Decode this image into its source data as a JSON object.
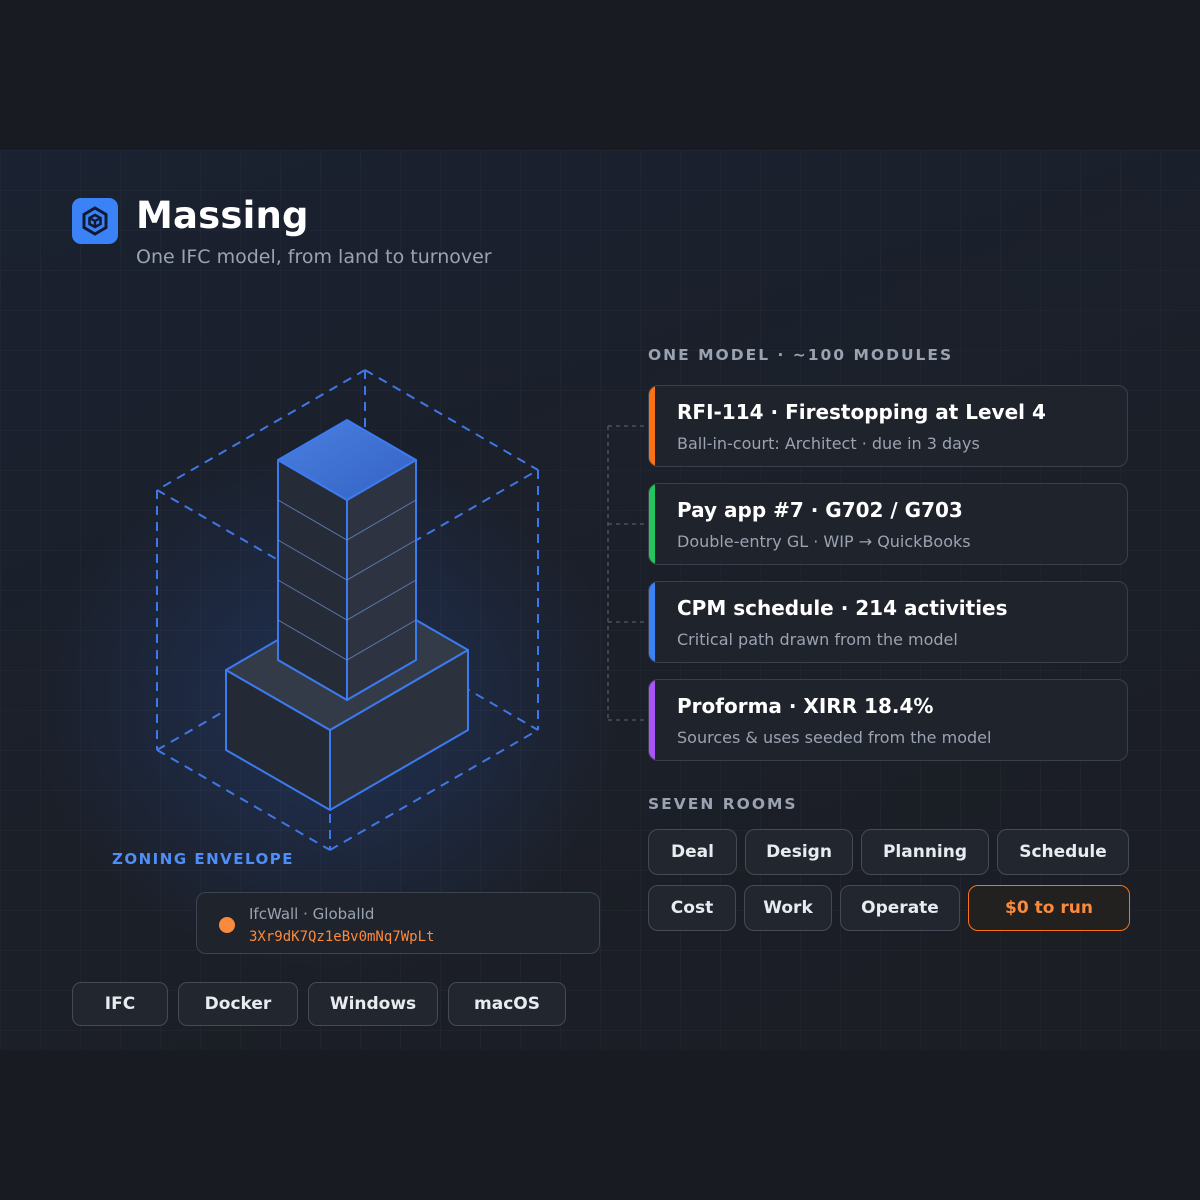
{
  "app": {
    "title": "Massing",
    "subtitle": "One IFC model, from land to turnover"
  },
  "visual": {
    "zoning_label": "ZONING ENVELOPE",
    "ifc_card": {
      "label": "IfcWall · GlobalId",
      "global_id": "3Xr9dK7Qz1eBv0mNq7WpLt"
    }
  },
  "platforms": [
    "IFC",
    "Docker",
    "Windows",
    "macOS"
  ],
  "modules": {
    "heading": "ONE MODEL · ~100 MODULES",
    "items": [
      {
        "title": "RFI-114 · Firestopping at Level 4",
        "subtitle": "Ball-in-court: Architect · due in 3 days",
        "color": "#f97316"
      },
      {
        "title": "Pay app #7 · G702 / G703",
        "subtitle": "Double-entry GL · WIP → QuickBooks",
        "color": "#22c55e"
      },
      {
        "title": "CPM schedule · 214 activities",
        "subtitle": "Critical path drawn from the model",
        "color": "#3b82f6"
      },
      {
        "title": "Proforma · XIRR 18.4%",
        "subtitle": "Sources & uses seeded from the model",
        "color": "#a855f7"
      }
    ]
  },
  "rooms": {
    "heading": "SEVEN ROOMS",
    "items": [
      "Deal",
      "Design",
      "Planning",
      "Schedule",
      "Cost",
      "Work",
      "Operate"
    ],
    "cta": "$0 to run"
  },
  "colors": {
    "accent_blue": "#3b82f6",
    "accent_orange": "#f97316",
    "background": "#181b21"
  }
}
